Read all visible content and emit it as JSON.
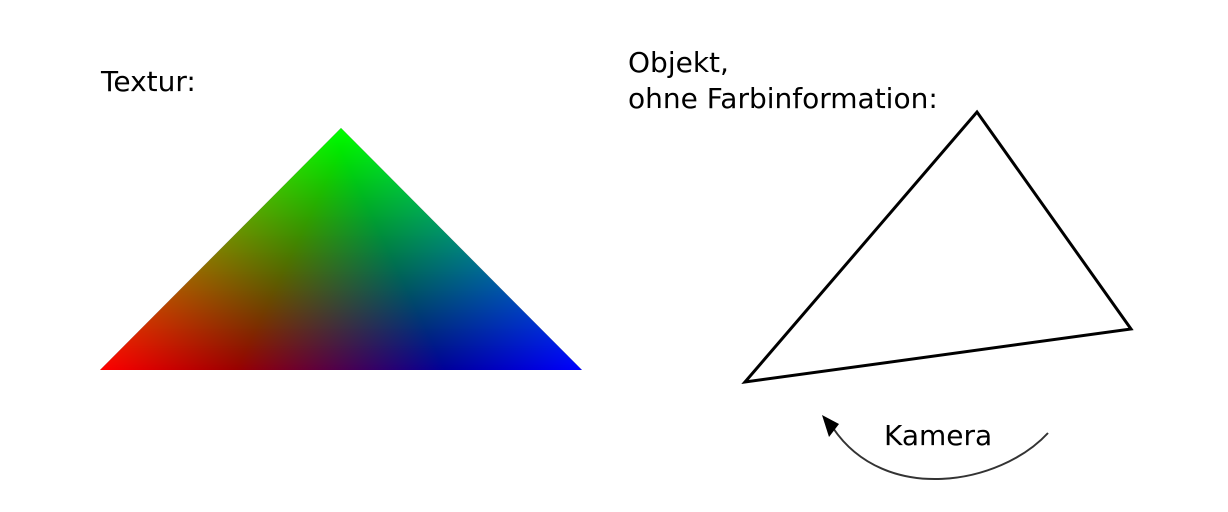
{
  "texture": {
    "label": "Textur:",
    "vertex_colors": {
      "left": "#ff0000",
      "apex": "#00ff00",
      "right": "#0000ff"
    }
  },
  "object": {
    "label_line1": "Objekt,",
    "label_line2": "ohne Farbinformation:",
    "outline_color": "#000000"
  },
  "camera": {
    "label": "Kamera",
    "arrow_color": "#333333"
  }
}
